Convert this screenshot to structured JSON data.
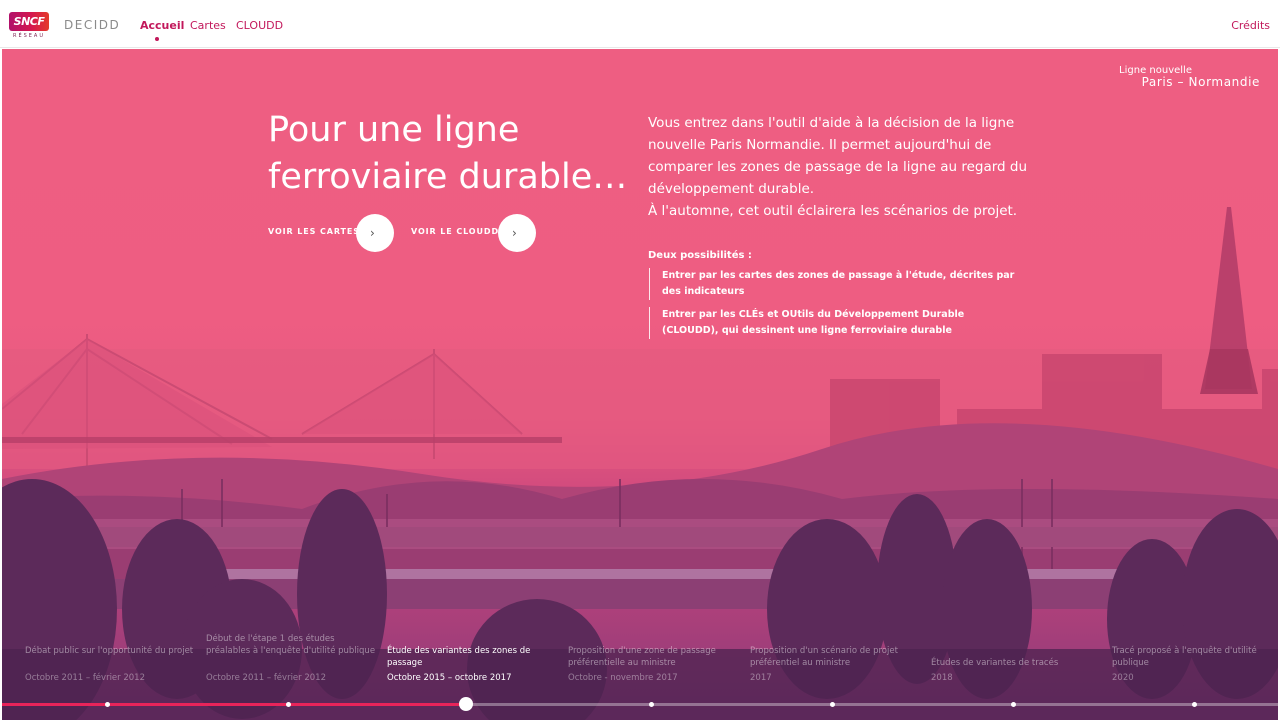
{
  "header": {
    "logo_text": "SNCF",
    "logo_subtext": "RÉSEAU",
    "app_name": "DECIDD",
    "nav": [
      {
        "label": "Accueil",
        "active": true
      },
      {
        "label": "Cartes",
        "active": false
      },
      {
        "label": "CLOUDD",
        "active": false
      }
    ],
    "credits": "Crédits"
  },
  "brand": {
    "line1": "Ligne nouvelle",
    "line2": "Paris – Normandie"
  },
  "hero": {
    "headline": "Pour une ligne ferroviaire durable…",
    "cta_maps": "VOIR LES CARTES",
    "cta_cloudd": "VOIR LE CLOUDD",
    "intro_1": "Vous entrez dans l'outil d'aide à la décision de la ligne nouvelle Paris Normandie. Il permet aujourd'hui de comparer les zones de passage de la ligne au regard du développement durable.",
    "intro_2": "À l'automne, cet outil éclairera les scénarios de projet.",
    "possibilities_title": "Deux possibilités :",
    "possibilities": [
      "Entrer par les cartes des zones de passage à l'étude, décrites par des indicateurs",
      "Entrer par les CLÉs et OUtils du Développement Durable (CLOUDD), qui dessinent une ligne ferroviaire durable"
    ]
  },
  "timeline": {
    "progress_percent": 36.5,
    "steps": [
      {
        "label": "Débat public sur l'opportunité du projet",
        "date": "Octobre 2011 – février 2012",
        "active": false
      },
      {
        "label": "Début de l'étape 1 des études préalables à l'enquête d'utilité publique",
        "date": "Octobre 2011 – février 2012",
        "active": false
      },
      {
        "label": "Étude des variantes des zones de passage",
        "date": "Octobre 2015 – octobre 2017",
        "active": true
      },
      {
        "label": "Proposition d'une zone de passage préférentielle au ministre",
        "date": "Octobre - novembre 2017",
        "active": false
      },
      {
        "label": "Proposition d'un scénario de projet préférentiel au ministre",
        "date": "2017",
        "active": false
      },
      {
        "label": "Études de variantes de tracés",
        "date": "2018",
        "active": false
      },
      {
        "label": "Tracé proposé à l'enquête d'utilité publique",
        "date": "2020",
        "active": false
      }
    ]
  },
  "colors": {
    "accent": "#c2185b",
    "hero_pink": "#ee5e82",
    "progress": "#e8245a"
  }
}
